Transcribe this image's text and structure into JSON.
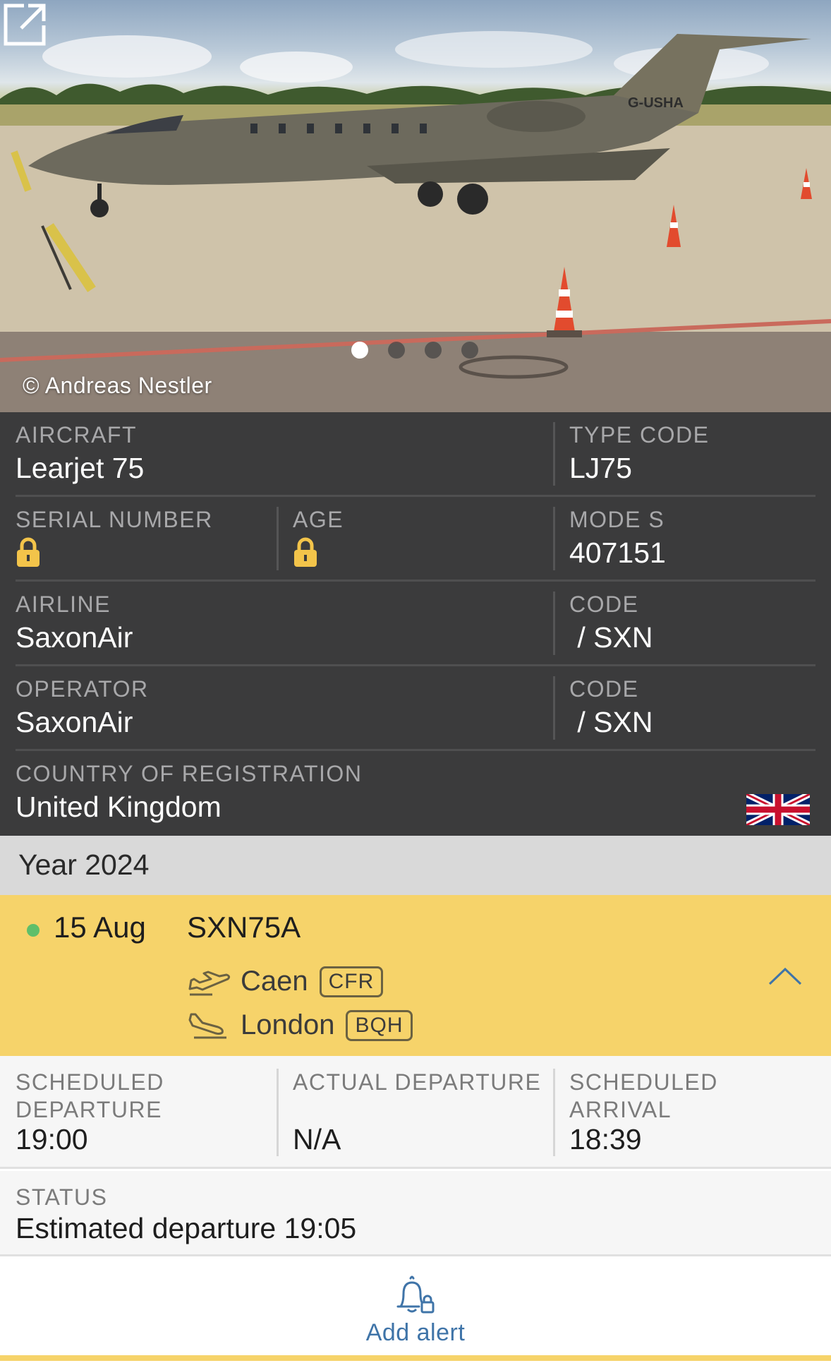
{
  "photo": {
    "credit": "© Andreas Nestler",
    "tail_registration": "G-USHA",
    "carousel_count": 4,
    "carousel_active_index": 0,
    "expand_icon": "external-link-icon"
  },
  "aircraft": {
    "aircraft_label": "AIRCRAFT",
    "aircraft_value": "Learjet 75",
    "type_code_label": "TYPE CODE",
    "type_code_value": "LJ75",
    "serial_label": "SERIAL NUMBER",
    "serial_icon": "lock-icon",
    "age_label": "AGE",
    "age_icon": "lock-icon",
    "mode_s_label": "MODE S",
    "mode_s_value": "407151",
    "airline_label": "AIRLINE",
    "airline_value": "SaxonAir",
    "airline_code_label": "CODE",
    "airline_code_value": " / SXN",
    "operator_label": "OPERATOR",
    "operator_value": "SaxonAir",
    "operator_code_label": "CODE",
    "operator_code_value": " / SXN",
    "country_label": "COUNTRY OF REGISTRATION",
    "country_value": "United Kingdom",
    "flag_icon": "uk-flag-icon"
  },
  "history": {
    "year_label": "Year 2024"
  },
  "flight": {
    "date": "15 Aug",
    "number": "SXN75A",
    "live_color": "#5fbf6a",
    "origin_city": "Caen",
    "origin_code": "CFR",
    "destination_city": "London",
    "destination_code": "BQH"
  },
  "details": {
    "sched_dep_label": "SCHEDULED DEPARTURE",
    "sched_dep_value": "19:00",
    "actual_dep_label": "ACTUAL DEPARTURE",
    "actual_dep_value": "N/A",
    "sched_arr_label": "SCHEDULED ARRIVAL",
    "sched_arr_value": "18:39",
    "status_label": "STATUS",
    "status_value": "Estimated departure 19:05"
  },
  "alert": {
    "label": "Add alert",
    "icon": "bell-lock-icon"
  },
  "colors": {
    "panel_bg": "#3b3b3c",
    "flight_highlight": "#f6d36a",
    "link_blue": "#3f74a8",
    "lock_yellow": "#f3c44a"
  }
}
